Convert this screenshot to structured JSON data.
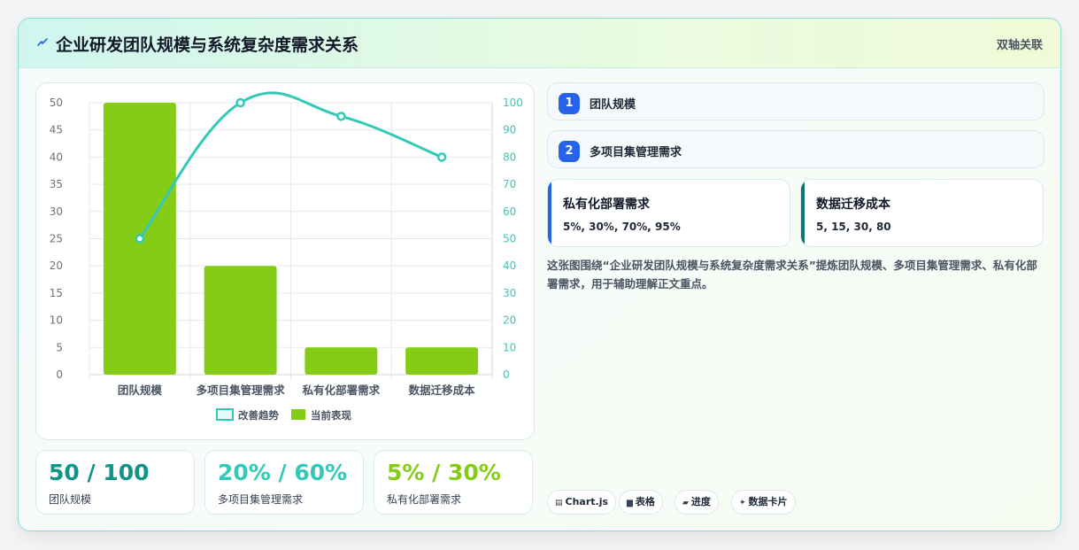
{
  "header": {
    "title": "企业研发团队规模与系统复杂度需求关系",
    "right_label": "双轴关联",
    "icon": "lightning-icon"
  },
  "chart_data": {
    "type": "bar",
    "categories": [
      "团队规模",
      "多项目集管理需求",
      "私有化部署需求",
      "数据迁移成本"
    ],
    "series": [
      {
        "name": "改善趋势",
        "type": "line",
        "axis": "right",
        "values": [
          50,
          100,
          95,
          80
        ],
        "color": "#33c9b8"
      },
      {
        "name": "当前表现",
        "type": "bar",
        "axis": "left",
        "values": [
          50,
          20,
          5,
          5
        ],
        "color": "#84cc16"
      }
    ],
    "left_axis": {
      "ylim": [
        0,
        50
      ],
      "ticks": [
        0,
        5,
        10,
        15,
        20,
        25,
        30,
        35,
        40,
        45,
        50
      ]
    },
    "right_axis": {
      "ylim": [
        0,
        100
      ],
      "ticks": [
        0,
        10,
        20,
        30,
        40,
        50,
        60,
        70,
        80,
        90,
        100
      ]
    },
    "legend": "bottom",
    "grid": true
  },
  "stats": [
    {
      "value": "50 / 100",
      "label": "团队规模",
      "color": "#0f9488"
    },
    {
      "value": "20% / 60%",
      "label": "多项目集管理需求",
      "color": "#33c9b8"
    },
    {
      "value": "5% / 30%",
      "label": "私有化部署需求",
      "color": "#84cc16"
    }
  ],
  "steps": [
    {
      "num": "1",
      "label": "团队规模"
    },
    {
      "num": "2",
      "label": "多项目集管理需求"
    }
  ],
  "info_cards": [
    {
      "title": "私有化部署需求",
      "values": "5%, 30%, 70%, 95%",
      "accent": "#2563eb"
    },
    {
      "title": "数据迁移成本",
      "values": "5, 15, 30, 80",
      "accent": "#0f766e"
    }
  ],
  "description": "这张图围绕“企业研发团队规模与系统复杂度需求关系”提炼团队规模、多项目集管理需求、私有化部署需求，用于辅助理解正文重点。",
  "chips": [
    {
      "icon": "chart-icon",
      "label": "Chart.js"
    },
    {
      "icon": "table-icon",
      "label": "表格"
    },
    {
      "icon": "progress-icon",
      "label": "进度"
    },
    {
      "icon": "sparkle-icon",
      "label": "数据卡片"
    }
  ]
}
